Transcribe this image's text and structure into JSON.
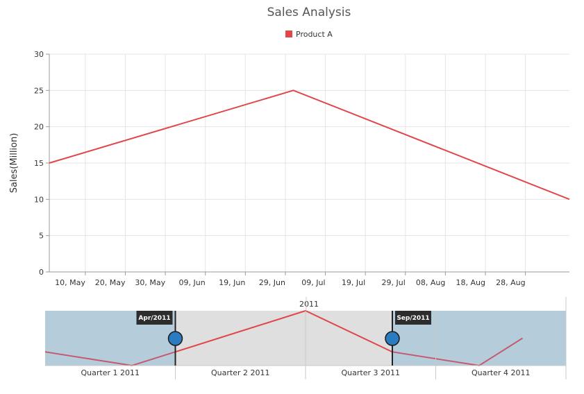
{
  "chart_data": {
    "type": "line",
    "title": "Sales Analysis",
    "legend": {
      "position": "top",
      "entries": [
        "Product A"
      ]
    },
    "ylabel": "Sales(Million)",
    "xlabel": "",
    "ylim": [
      0,
      30
    ],
    "y_ticks": [
      0,
      5,
      10,
      15,
      20,
      25,
      30
    ],
    "x_range": [
      "2011-05-01",
      "2011-09-08"
    ],
    "x_ticks": [
      {
        "date": "2011-05-10",
        "label": "10, May"
      },
      {
        "date": "2011-05-20",
        "label": "20, May"
      },
      {
        "date": "2011-05-30",
        "label": "30, May"
      },
      {
        "date": "2011-06-09",
        "label": "09, Jun"
      },
      {
        "date": "2011-06-19",
        "label": "19, Jun"
      },
      {
        "date": "2011-06-29",
        "label": "29, Jun"
      },
      {
        "date": "2011-07-09",
        "label": "09, Jul"
      },
      {
        "date": "2011-07-19",
        "label": "19, Jul"
      },
      {
        "date": "2011-07-29",
        "label": "29, Jul"
      },
      {
        "date": "2011-08-08",
        "label": "08, Aug"
      },
      {
        "date": "2011-08-18",
        "label": "18, Aug"
      },
      {
        "date": "2011-08-28",
        "label": "28, Aug"
      }
    ],
    "grid": true,
    "color": "#e0474c",
    "series": [
      {
        "name": "Product A",
        "color": "#e0474c",
        "points": [
          {
            "x": "2011-05-01",
            "y": 15
          },
          {
            "x": "2011-07-01",
            "y": 25
          },
          {
            "x": "2011-09-08",
            "y": 10
          }
        ]
      }
    ]
  },
  "navigator": {
    "year_label": "2011",
    "quarters": [
      "Quarter 1 2011",
      "Quarter 2 2011",
      "Quarter 3 2011",
      "Quarter 4 2011"
    ],
    "selection_start_label": "Apr/2011",
    "selection_end_label": "Sep/2011",
    "series_months": [
      1,
      3,
      5,
      7,
      9,
      11,
      12
    ],
    "series_values": [
      10,
      5,
      15,
      25,
      10,
      5,
      15
    ],
    "selection_range_months": [
      4,
      9
    ],
    "colors": {
      "unselected": "#b5cddb",
      "selected": "#dfdfdf",
      "handle": "#2b7bc1",
      "line_unselected": "#c45a6e",
      "line_selected": "#e0474c"
    }
  }
}
